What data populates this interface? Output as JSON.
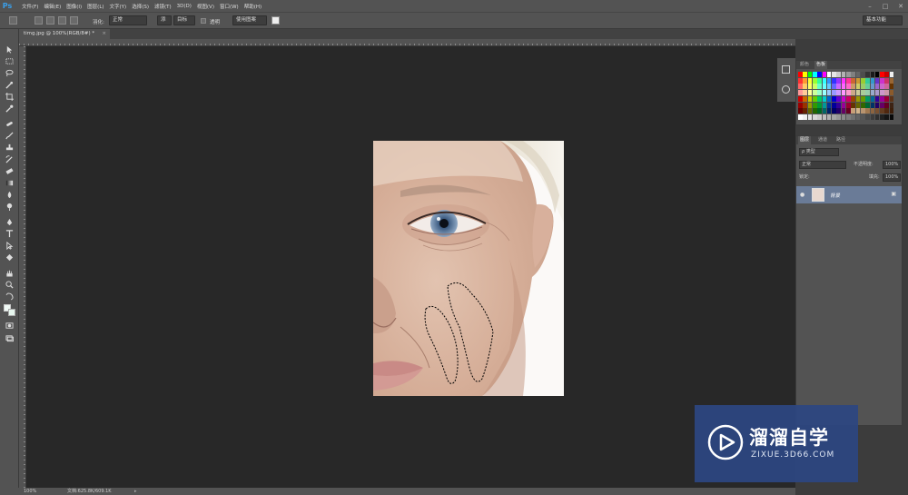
{
  "app": {
    "logo": "Ps"
  },
  "menu": {
    "items": [
      "文件(F)",
      "编辑(E)",
      "图像(I)",
      "图层(L)",
      "文字(Y)",
      "选择(S)",
      "滤镜(T)",
      "3D(D)",
      "视图(V)",
      "窗口(W)",
      "帮助(H)"
    ]
  },
  "options": {
    "feather_label": "羽化:",
    "mode_value": "正常",
    "btn_1": "添",
    "btn_2": "目标",
    "transparent_label": "透明",
    "use_pattern": "使用图案",
    "workspace": "基本功能"
  },
  "tab": {
    "title": "timg.jpg @ 100%(RGB/8#) *",
    "close": "×"
  },
  "status": {
    "zoom": "100%",
    "doc": "文档:625.8K/609.1K"
  },
  "swatches": {
    "tabs": [
      "颜色",
      "色板"
    ],
    "colors": [
      "#ff0000",
      "#ffff00",
      "#00ff00",
      "#00ffff",
      "#0000ff",
      "#ff00ff",
      "#ffffff",
      "#e6e6e6",
      "#cccccc",
      "#b3b3b3",
      "#999999",
      "#808080",
      "#666666",
      "#4d4d4d",
      "#333333",
      "#1a1a1a",
      "#000000",
      "#ff0000",
      "#c80000",
      "#f0f0f0",
      "#ff3333",
      "#ff9933",
      "#ffff33",
      "#99ff33",
      "#33ff99",
      "#33ffff",
      "#3399ff",
      "#3333ff",
      "#9933ff",
      "#ff33ff",
      "#ff3399",
      "#cc6633",
      "#cc9933",
      "#99cc33",
      "#33cc99",
      "#3399cc",
      "#6633cc",
      "#cc33cc",
      "#cc3366",
      "#996633",
      "#ff6666",
      "#ffcc66",
      "#ffff66",
      "#ccff66",
      "#66ffcc",
      "#66ffff",
      "#66ccff",
      "#6666ff",
      "#cc66ff",
      "#ff66ff",
      "#ff66cc",
      "#cc9966",
      "#cccc66",
      "#99cc66",
      "#66cc99",
      "#6699cc",
      "#9966cc",
      "#cc66cc",
      "#cc6699",
      "#663300",
      "#ff9999",
      "#ffcc99",
      "#ffff99",
      "#ccff99",
      "#99ffcc",
      "#99ffff",
      "#99ccff",
      "#9999ff",
      "#cc99ff",
      "#ff99ff",
      "#ff99cc",
      "#ccaa88",
      "#cccc99",
      "#aacc99",
      "#99ccaa",
      "#99aacc",
      "#aa99cc",
      "#cc99cc",
      "#cc99aa",
      "#8b5a2b",
      "#cc0000",
      "#cc6600",
      "#cccc00",
      "#66cc00",
      "#00cc66",
      "#00cccc",
      "#0066cc",
      "#0000cc",
      "#6600cc",
      "#cc00cc",
      "#cc0066",
      "#994400",
      "#999900",
      "#669900",
      "#009966",
      "#006699",
      "#330099",
      "#990099",
      "#990033",
      "#5c3317",
      "#990000",
      "#993300",
      "#999900",
      "#339900",
      "#009933",
      "#009999",
      "#003399",
      "#000099",
      "#330099",
      "#990099",
      "#990033",
      "#663300",
      "#666600",
      "#336600",
      "#006633",
      "#003366",
      "#220066",
      "#660066",
      "#660022",
      "#3d2314",
      "#660000",
      "#662200",
      "#666600",
      "#226600",
      "#006622",
      "#006666",
      "#002266",
      "#000066",
      "#220066",
      "#660066",
      "#660022",
      "#c8a078",
      "#d2b48c",
      "#b89470",
      "#a07850",
      "#8c6440",
      "#785030",
      "#643c20",
      "#502810",
      "#3c1e0a",
      "#ffffff",
      "#f2f2f2",
      "#e5e5e5",
      "#d8d8d8",
      "#cbcbcb",
      "#bebebe",
      "#b1b1b1",
      "#a4a4a4",
      "#979797",
      "#8a8a8a",
      "#7d7d7d",
      "#707070",
      "#636363",
      "#565656",
      "#494949",
      "#3c3c3c",
      "#2f2f2f",
      "#222222",
      "#151515",
      "#080808"
    ]
  },
  "layers": {
    "tabs": [
      "图层",
      "通道",
      "路径"
    ],
    "filter_kind": "ρ 类型",
    "blend_mode": "正常",
    "opacity_label": "不透明度:",
    "opacity_value": "100%",
    "lock_label": "锁定:",
    "fill_label": "填充:",
    "fill_value": "100%",
    "layer_name": "背景"
  },
  "watermark": {
    "brand": "溜溜自学",
    "url": "ZIXUE.3D66.COM"
  }
}
